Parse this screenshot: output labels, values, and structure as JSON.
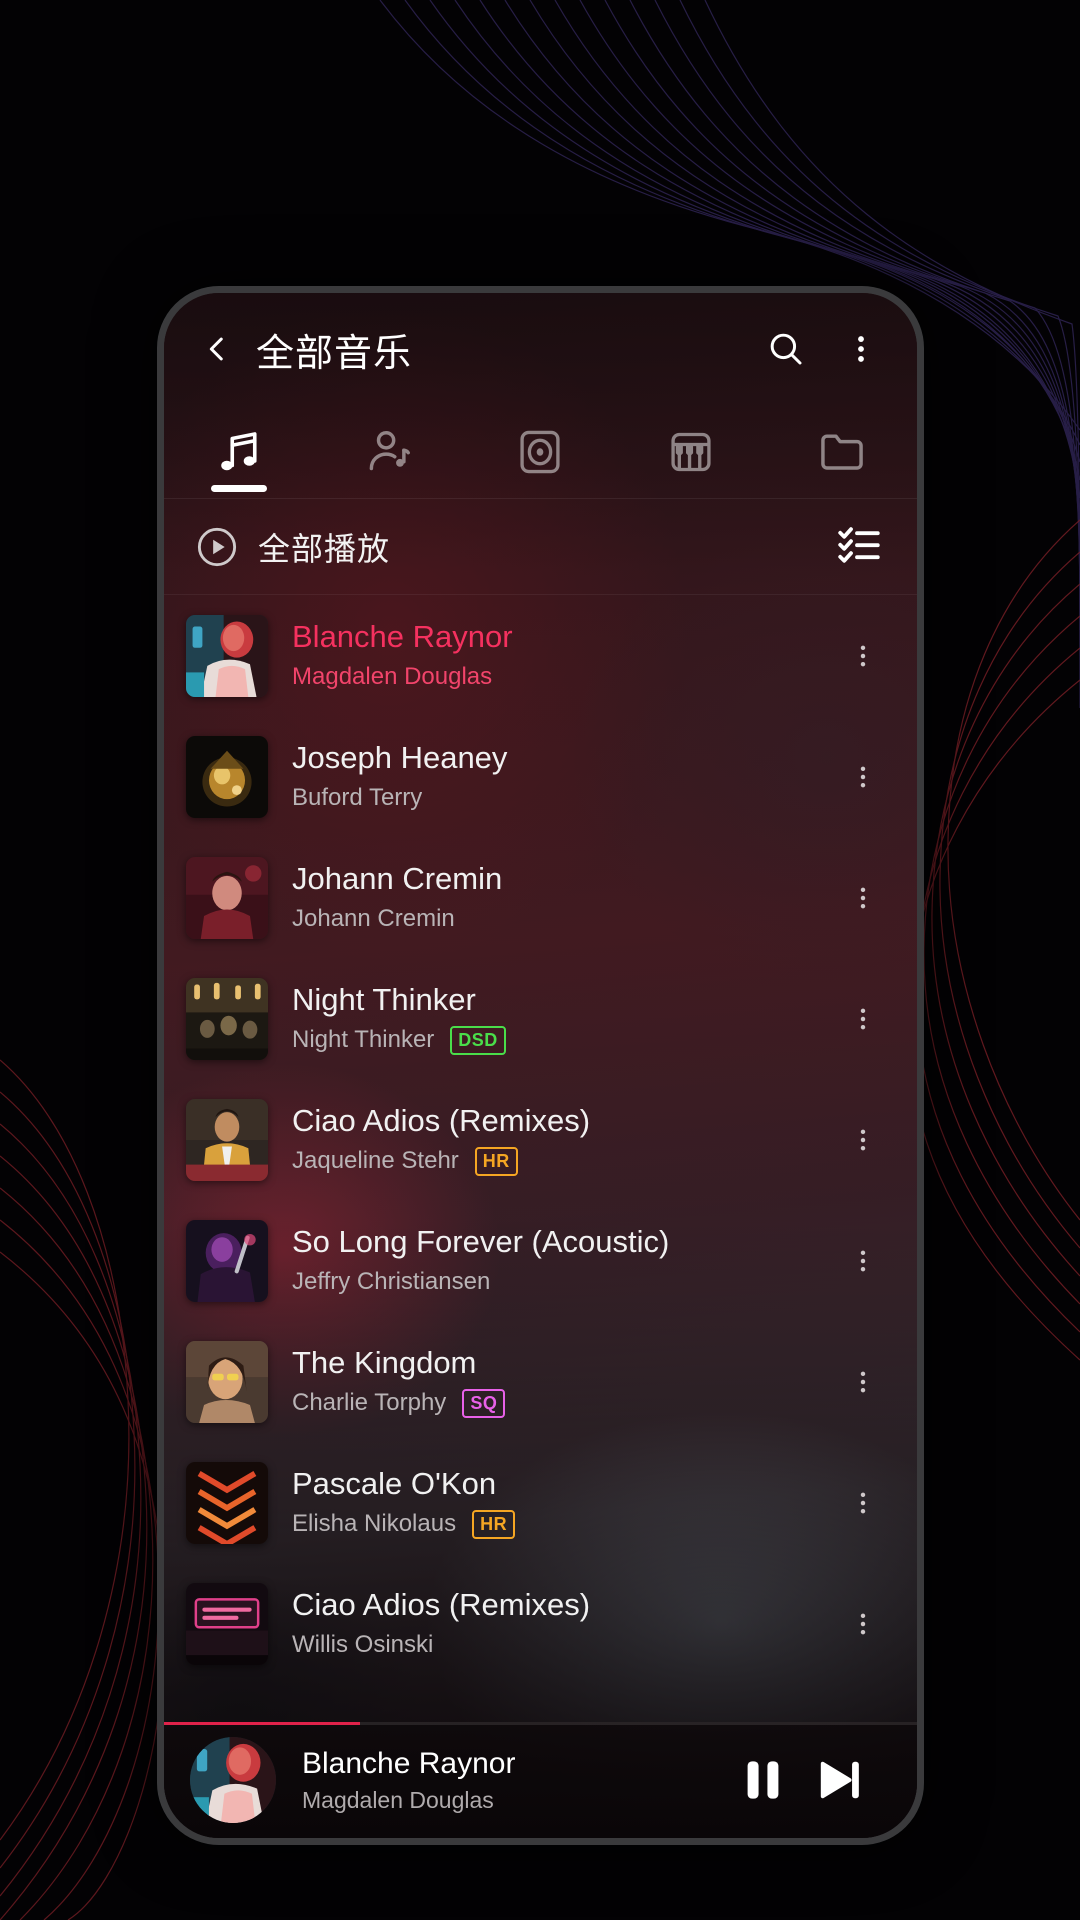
{
  "wallpaper": {
    "name": "dark-contour-lines-wallpaper",
    "accent": "#2a2048",
    "accent2": "#6e1f22"
  },
  "appbar": {
    "back_icon": "chevron-left-icon",
    "title": "全部音乐",
    "search_icon": "search-icon",
    "overflow_icon": "overflow-menu-icon"
  },
  "tabs": [
    {
      "id": "songs",
      "icon": "music-note-icon",
      "active": true
    },
    {
      "id": "artists",
      "icon": "artist-icon",
      "active": false
    },
    {
      "id": "albums",
      "icon": "album-disc-icon",
      "active": false
    },
    {
      "id": "genres",
      "icon": "piano-keys-icon",
      "active": false
    },
    {
      "id": "folders",
      "icon": "folder-icon",
      "active": false
    }
  ],
  "playall": {
    "play_icon": "play-circle-icon",
    "label": "全部播放",
    "multiselect_icon": "checklist-icon"
  },
  "songs": [
    {
      "title": "Blanche Raynor",
      "artist": "Magdalen Douglas",
      "badge": "",
      "playing": true,
      "art": "art-man-red-neon"
    },
    {
      "title": "Joseph Heaney",
      "artist": "Buford Terry",
      "badge": "",
      "playing": false,
      "art": "art-gold-ornament"
    },
    {
      "title": "Johann Cremin",
      "artist": "Johann Cremin",
      "badge": "",
      "playing": false,
      "art": "art-portrait-red"
    },
    {
      "title": "Night Thinker",
      "artist": "Night Thinker",
      "badge": "DSD",
      "playing": false,
      "art": "art-band-stage"
    },
    {
      "title": "Ciao Adios (Remixes)",
      "artist": "Jaqueline Stehr",
      "badge": "HR",
      "playing": false,
      "art": "art-man-yellow-jacket"
    },
    {
      "title": "So Long Forever (Acoustic)",
      "artist": "Jeffry Christiansen",
      "badge": "",
      "playing": false,
      "art": "art-singer-purple"
    },
    {
      "title": "The Kingdom",
      "artist": "Charlie Torphy",
      "badge": "SQ",
      "playing": false,
      "art": "art-woman-sunglasses"
    },
    {
      "title": "Pascale O'Kon",
      "artist": "Elisha Nikolaus",
      "badge": "HR",
      "playing": false,
      "art": "art-neon-arrows"
    },
    {
      "title": "Ciao Adios (Remixes)",
      "artist": "Willis Osinski",
      "badge": "",
      "playing": false,
      "art": "art-neon-sign-pink"
    }
  ],
  "miniplayer": {
    "title": "Blanche Raynor",
    "artist": "Magdalen Douglas",
    "pause_icon": "pause-icon",
    "next_icon": "skip-next-icon",
    "progress_percent": 26,
    "art": "art-man-red-neon"
  },
  "colors": {
    "accent_pink": "#f5315f",
    "badge_dsd": "#4ade4a",
    "badge_hr": "#f5a623",
    "badge_sq": "#e861e8",
    "text_primary": "#f1f1f1",
    "text_secondary": "#b9b4b6"
  }
}
